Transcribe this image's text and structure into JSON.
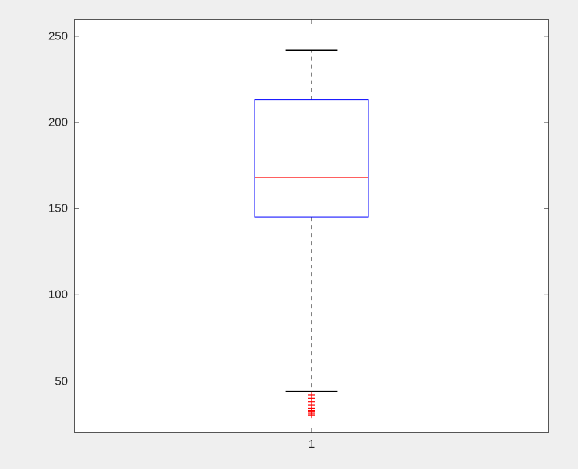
{
  "chart_data": {
    "type": "boxplot",
    "categories": [
      "1"
    ],
    "series": [
      {
        "name": "1",
        "q1": 145,
        "median": 168,
        "q3": 213,
        "whisker_low": 44,
        "whisker_high": 242,
        "outliers": [
          30,
          31,
          32,
          32,
          33,
          33,
          34,
          36,
          38,
          40,
          42
        ]
      }
    ],
    "y_ticks": [
      50,
      100,
      150,
      200,
      250
    ],
    "x_ticks": [
      "1"
    ],
    "ylim": [
      20,
      260
    ],
    "xlabel": "",
    "ylabel": "",
    "title": "",
    "box_color": "#0000ff",
    "median_color": "#ff0000",
    "whisker_color": "#000000",
    "outlier_color": "#ff0000"
  },
  "layout": {
    "axes_left": 94,
    "axes_top": 24,
    "axes_width": 600,
    "axes_height": 524,
    "tick_len": 6,
    "box_width_frac": 0.24
  }
}
